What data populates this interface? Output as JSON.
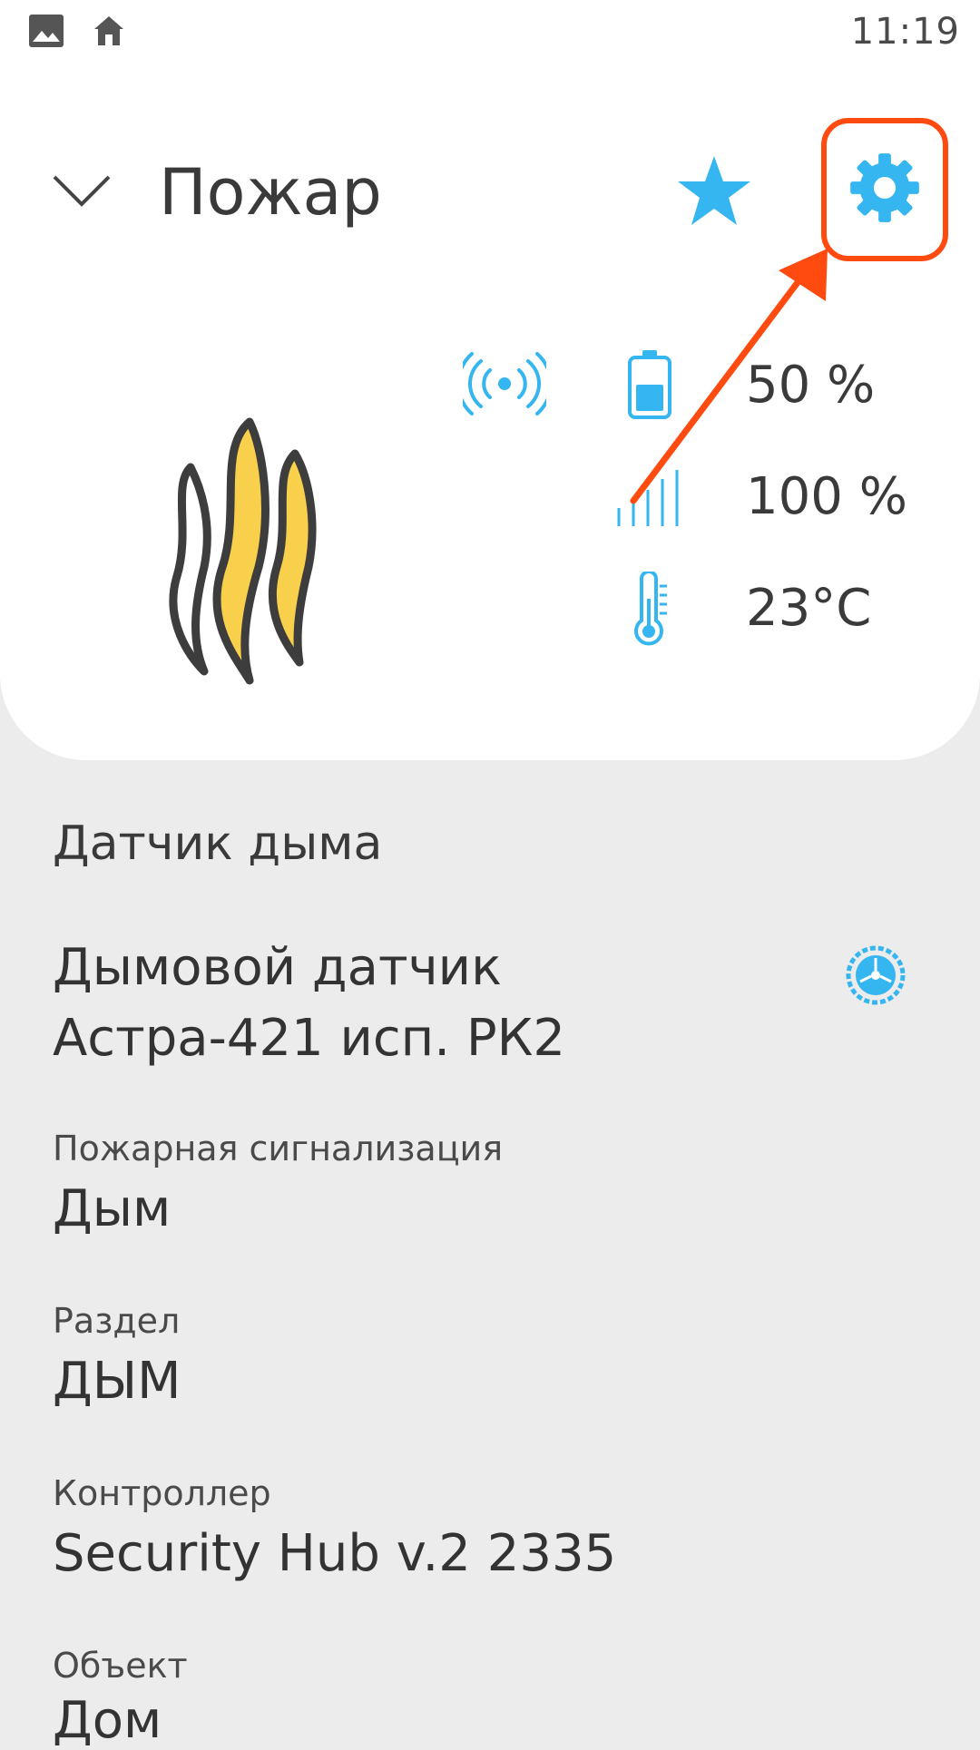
{
  "status_bar": {
    "time": "11:19",
    "left_icons": [
      "gallery-icon",
      "home-icon"
    ]
  },
  "header": {
    "title": "Пожар"
  },
  "metrics": {
    "battery": "50 %",
    "signal": "100 %",
    "temperature": "23°C"
  },
  "details": {
    "type_name": "Датчик дыма",
    "model": "Дымовой датчик Астра-421 исп. РК2",
    "fire_alarm_label": "Пожарная сигнализация",
    "fire_alarm_value": "Дым",
    "section_label": "Раздел",
    "section_value": "ДЫМ",
    "controller_label": "Контроллер",
    "controller_value": "Security Hub v.2 2335",
    "object_label": "Объект",
    "object_value": "Дом"
  },
  "colors": {
    "accent_blue": "#35b6f0",
    "highlight_orange": "#ff4a10",
    "flame_yellow": "#f8d04c",
    "flame_outline": "#3d3d3d"
  }
}
